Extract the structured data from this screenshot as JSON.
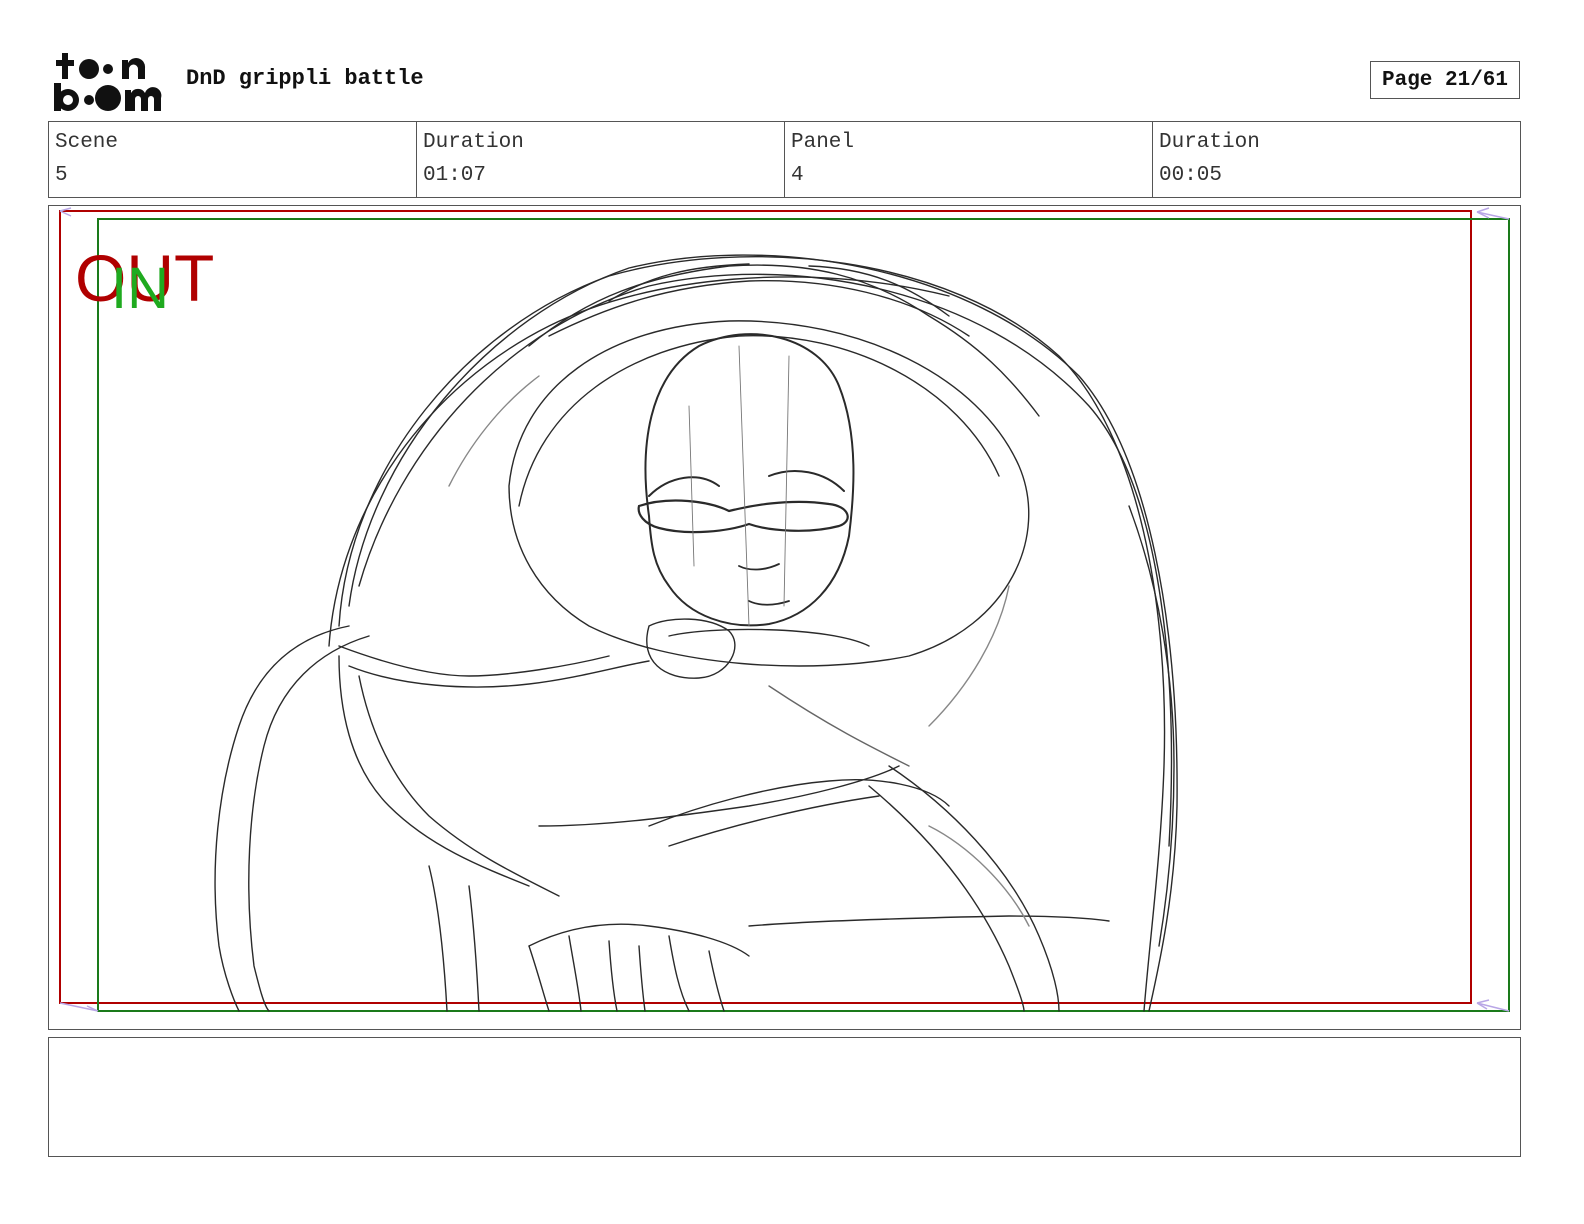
{
  "header": {
    "logo_top": "to•n",
    "logo_bottom": "b••m",
    "title": "DnD grippli battle",
    "page": "Page 21/61"
  },
  "info": [
    {
      "label": "Scene",
      "value": "5"
    },
    {
      "label": "Duration",
      "value": "01:07"
    },
    {
      "label": "Panel",
      "value": "4"
    },
    {
      "label": "Duration",
      "value": "00:05"
    }
  ],
  "panel": {
    "marker_out": "OUT",
    "marker_in": "IN",
    "out_color": "#b00000",
    "in_color": "#1faa1f"
  },
  "notes": {
    "text": ""
  }
}
